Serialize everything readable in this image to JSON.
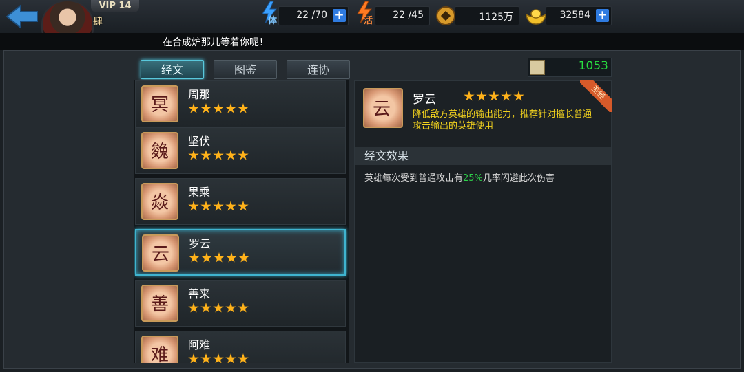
{
  "header": {
    "vip": "VIP 14",
    "rank_badge": "肆",
    "stamina": {
      "icon": "lightning-icon",
      "label": "体",
      "value": "22 /70"
    },
    "activity": {
      "icon": "lightning-icon",
      "label": "活",
      "value": "22 /45"
    },
    "coins": {
      "icon": "copper-coin-icon",
      "value": "1125万"
    },
    "gold": {
      "icon": "gold-ingot-icon",
      "value": "32584"
    }
  },
  "hint": "在合成炉那儿等着你呢！",
  "tabs": [
    {
      "label": "经文",
      "active": true
    },
    {
      "label": "图鉴",
      "active": false
    },
    {
      "label": "连协",
      "active": false
    }
  ],
  "scroll_count": "1053",
  "list": [
    {
      "name": "周那",
      "stars": 5
    },
    {
      "name": "坚伏",
      "stars": 5
    },
    {
      "name": "果乘",
      "stars": 5
    },
    {
      "name": "罗云",
      "stars": 5,
      "selected": true
    },
    {
      "name": "善来",
      "stars": 5
    },
    {
      "name": "阿难",
      "stars": 5
    }
  ],
  "detail": {
    "name": "罗云",
    "stars": 5,
    "badge": "圣经",
    "description": "降低敌方英雄的输出能力，推荐针对擅长普通攻击输出的英雄使用",
    "effect_title": "经文效果",
    "effect_prefix": "英雄每次受到普通攻击有",
    "effect_highlight": "25%",
    "effect_suffix": "几率闪避此次伤害"
  },
  "colors": {
    "accent_cyan": "#3fb4cf",
    "star": "#ffb21a",
    "desc_yellow": "#f2d21e",
    "count_green": "#28e040",
    "plus_blue": "#2f7be0"
  }
}
